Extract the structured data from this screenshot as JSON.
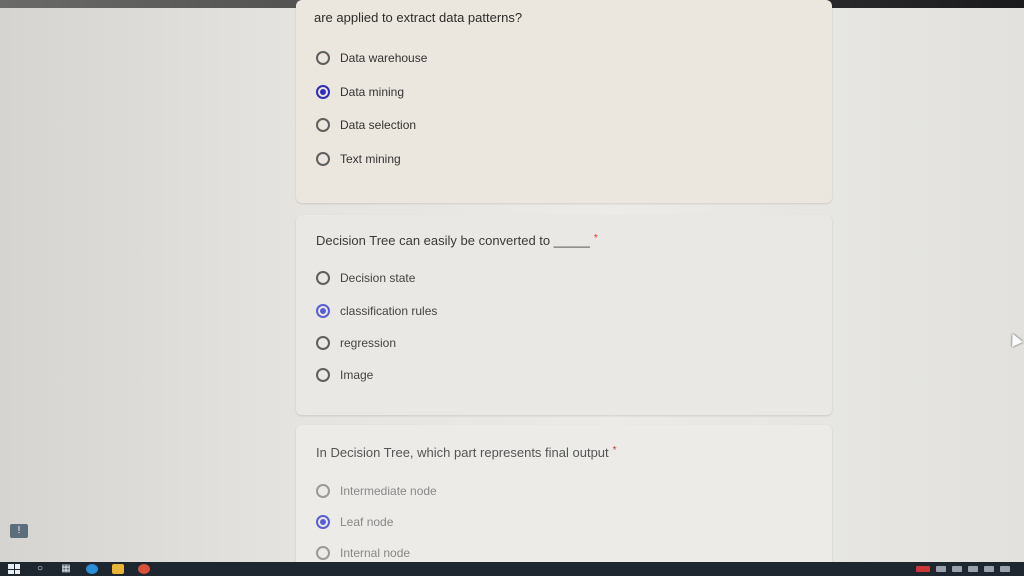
{
  "questions": [
    {
      "text": "are applied to extract data patterns?",
      "required": false,
      "options": [
        {
          "label": "Data warehouse",
          "selected": false
        },
        {
          "label": "Data mining",
          "selected": true
        },
        {
          "label": "Data selection",
          "selected": false
        },
        {
          "label": "Text mining",
          "selected": false
        }
      ]
    },
    {
      "text": "Decision Tree can easily be converted to _____",
      "required": true,
      "required_mark": "*",
      "options": [
        {
          "label": "Decision state",
          "selected": false
        },
        {
          "label": "classification rules",
          "selected": true
        },
        {
          "label": "regression",
          "selected": false
        },
        {
          "label": "Image",
          "selected": false
        }
      ]
    },
    {
      "text": "In Decision Tree, which part represents  final output",
      "required": true,
      "required_mark": "*",
      "options": [
        {
          "label": "Intermediate node",
          "selected": false
        },
        {
          "label": "Leaf node",
          "selected": true
        },
        {
          "label": "Internal node",
          "selected": false
        }
      ]
    }
  ],
  "feedback_icon": "feedback-icon",
  "taskbar": {
    "icons": [
      "windows-start-icon",
      "search-icon",
      "task-view-icon",
      "edge-browser-icon",
      "file-explorer-icon",
      "chrome-icon"
    ]
  },
  "colors": {
    "selected_radio": "#2e2fb5",
    "required_star": "#d93025",
    "taskbar": "#1e2630"
  }
}
